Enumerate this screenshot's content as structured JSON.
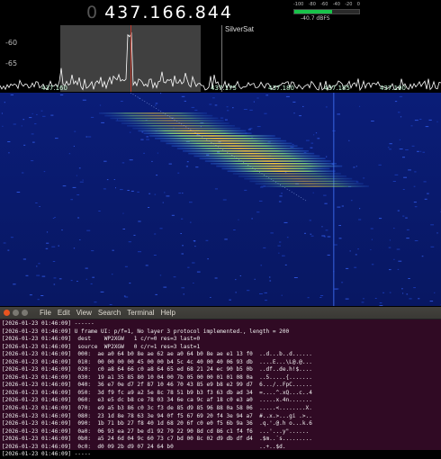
{
  "sdr": {
    "frequency_prefix": "0",
    "frequency": "437.166.844",
    "level_meter": {
      "ticks": [
        "-100",
        "-80",
        "-60",
        "-40",
        "-20",
        "0"
      ],
      "readout": "-40.7 dBFS",
      "level_fraction": 0.58
    },
    "db_labels": [
      "-60",
      "-65"
    ],
    "marker_label": "SilverSat",
    "freq_ticks": [
      "437.160",
      "437.175",
      "437.180",
      "437.185",
      "437.190"
    ],
    "colors": {
      "tune_line": "#c0392b",
      "spectrum": "#ffffff",
      "waterfall_bg": "#0a1a6e"
    }
  },
  "terminal": {
    "window_buttons": [
      "close-icon",
      "minimize-icon",
      "maximize-icon"
    ],
    "menu": [
      "File",
      "Edit",
      "View",
      "Search",
      "Terminal",
      "Help"
    ],
    "lines": [
      "[2026-01-23 01:46:09] ------",
      "[2026-01-23 01:46:09] U frame UI: p/f=1, No layer 3 protocol implemented., length = 200",
      "[2026-01-23 01:46:09]  dest    WP2XGW   1 c/r=0 res=3 last=0",
      "[2026-01-23 01:46:09]  source  WP2XGW   0 c/r=1 res=3 last=1",
      "[2026-01-23 01:46:09]  000:  ae a0 64 b0 8e ae 62 ae a0 64 b0 8e ae e1 13 f0  ..d...b..d......",
      "[2026-01-23 01:46:09]  010:  00 00 00 00 45 00 00 b4 5c 4c 40 00 40 06 93 db  ....E...\\L@.@...",
      "[2026-01-23 01:46:09]  020:  c0 a8 64 66 c0 a8 64 65 ed 68 21 24 ec 90 b5 0b  ..df..de.h!$....",
      "[2026-01-23 01:46:09]  030:  19 a1 35 85 80 10 04 00 7b 05 00 00 01 01 08 0a  ..5.....{.......",
      "[2026-01-23 01:46:09]  040:  36 e7 0e d7 2f 87 10 46 70 43 85 e9 b8 e2 99 d7  6.../..FpC......",
      "[2026-01-23 01:46:09]  050:  3d f9 fc a9 a2 5e 8c 78 51 b9 b3 f3 63 db ad 34  =....^.xQ...c..4",
      "[2026-01-23 01:46:09]  060:  e3 e5 dc b8 ce 78 03 34 6e ca 9c af 18 c0 e3 a0  .....x.4n.......",
      "[2026-01-23 01:46:09]  070:  e9 a5 b3 86 c0 3c f3 de 85 d9 85 96 88 0a 58 06  .....<........X.",
      "[2026-01-23 01:46:09]  080:  23 1d 8e 78 63 3e 94 0f f5 67 69 20 f4 3e 94 a7  #..x.>...gi .>..",
      "[2026-01-23 01:46:09]  090:  1b 71 bb 27 f8 40 1d 68 20 6f c0 e0 f5 6b 9a 36  .q.'.@.h o...k.6",
      "[2026-01-23 01:46:09]  0a0:  06 93 ea 27 be d1 92 79 22 90 8d cd 86 c1 f4 f6  ...'...y\"......",
      "[2026-01-23 01:46:09]  0b0:  a5 24 6d 04 9c 60 73 c7 bd 00 8c 02 d9 db df d4  .$m..`s.........",
      "[2026-01-23 01:46:09]  0c0:  d0 09 2b d9 07 24 64 b0                          ..+..$d.",
      "[2026-01-23 01:46:09] -----"
    ]
  }
}
